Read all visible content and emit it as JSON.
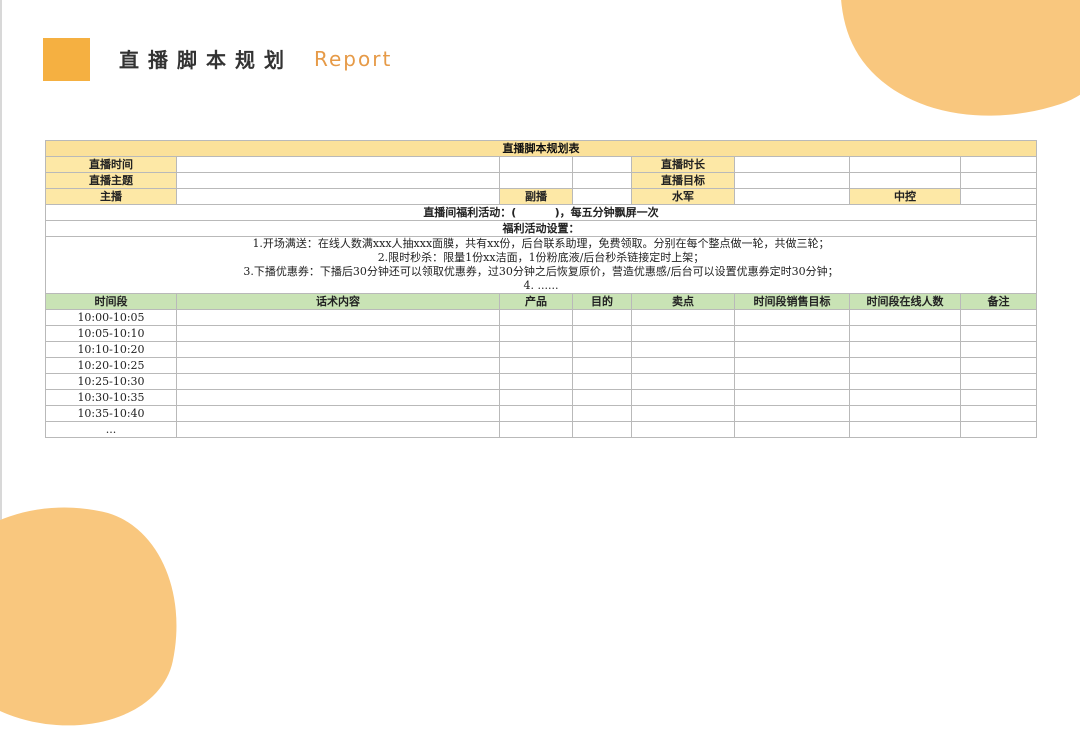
{
  "header": {
    "title": "直播脚本规划",
    "subtitle": "Report"
  },
  "table": {
    "title": "直播脚本规划表",
    "info": {
      "live_time": "直播时间",
      "live_duration": "直播时长",
      "live_theme": "直播主题",
      "live_target": "直播目标",
      "host": "主播",
      "co_host": "副播",
      "shill": "水军",
      "controller": "中控"
    },
    "welfare_activity": "直播间福利活动：(          )，每五分钟飘屏一次",
    "welfare_setting": "福利活动设置：",
    "rules": [
      "1.开场满送：在线人数满xxx人抽xxx面膜，共有xx份，后台联系助理，免费领取。分别在每个整点做一轮，共做三轮；",
      "2.限时秒杀：限量1份xx洁面，1份粉底液/后台秒杀链接定时上架；",
      "3.下播优惠券：下播后30分钟还可以领取优惠券，过30分钟之后恢复原价，营造优惠感/后台可以设置优惠券定时30分钟；",
      "4. ......"
    ],
    "columns": [
      "时间段",
      "话术内容",
      "产品",
      "目的",
      "卖点",
      "时间段销售目标",
      "时间段在线人数",
      "备注"
    ],
    "time_slots": [
      "10:00-10:05",
      "10:05-10:10",
      "10:10-10:20",
      "10:20-10:25",
      "10:25-10:30",
      "10:30-10:35",
      "10:35-10:40",
      "..."
    ]
  },
  "colors": {
    "accent": "#f5b041",
    "blob": "#f9c77e",
    "header_yellow": "#fde8a6",
    "header_green": "#c9e3b5"
  }
}
